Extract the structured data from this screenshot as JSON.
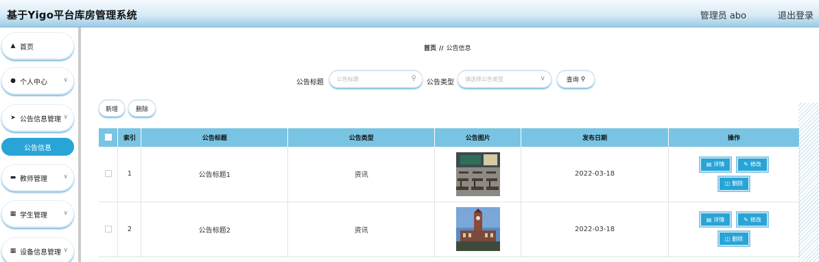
{
  "header": {
    "title": "基于Yigo平台库房管理系统",
    "admin_label": "管理员 abo",
    "logout_label": "退出登录"
  },
  "sidebar": {
    "items": [
      {
        "label": "首页",
        "icon": "home-icon",
        "has_arrow": false
      },
      {
        "label": "个人中心",
        "icon": "user-icon",
        "has_arrow": true
      },
      {
        "label": "公告信息管理",
        "icon": "send-icon",
        "has_arrow": true
      },
      {
        "label": "教师管理",
        "icon": "card-icon",
        "has_arrow": true
      },
      {
        "label": "学生管理",
        "icon": "grid-icon",
        "has_arrow": true
      },
      {
        "label": "设备信息管理",
        "icon": "grid-icon",
        "has_arrow": true
      }
    ],
    "active_item": "公告信息"
  },
  "breadcrumb": {
    "home": "首页",
    "separator": "//",
    "current": "公告信息"
  },
  "search": {
    "title_label": "公告标题",
    "title_placeholder": "公告标题",
    "type_label": "公告类型",
    "type_placeholder": "请选择公告类型",
    "query_label": "查询"
  },
  "actions": {
    "add_label": "新增",
    "delete_label": "删除"
  },
  "table": {
    "headers": [
      "索引",
      "公告标题",
      "公告类型",
      "公告图片",
      "发布日期",
      "操作"
    ],
    "rows": [
      {
        "index": "1",
        "title": "公告标题1",
        "type": "资讯",
        "date": "2022-03-18",
        "image": "classroom"
      },
      {
        "index": "2",
        "title": "公告标题2",
        "type": "资讯",
        "date": "2022-03-18",
        "image": "clocktower"
      }
    ],
    "op_labels": {
      "detail": "详情",
      "edit": "修改",
      "delete": "删除"
    }
  },
  "colors": {
    "accent": "#29a4d6",
    "table_header": "#79c4e3",
    "shadow": "#79b9dd"
  }
}
